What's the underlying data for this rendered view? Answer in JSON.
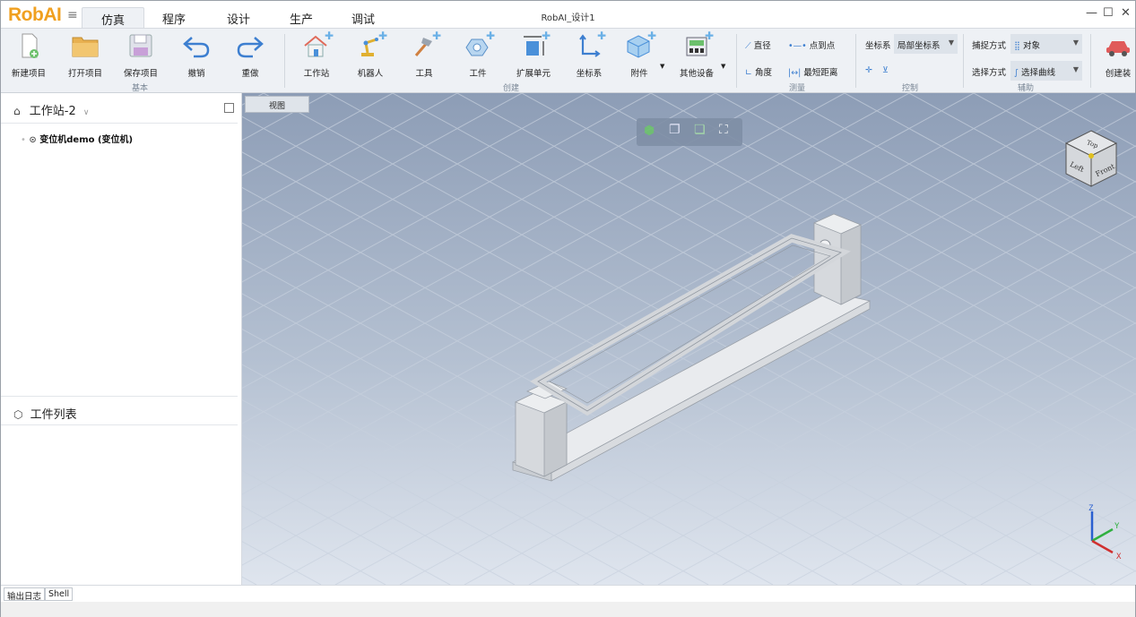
{
  "app": {
    "logo": "RobAI",
    "window_title": "RobAI_设计1",
    "window_controls": {
      "minimize": "—",
      "maximize": "☐",
      "close": "✕"
    }
  },
  "tabs": [
    "仿真",
    "程序",
    "设计",
    "生产",
    "调试"
  ],
  "active_tab": "仿真",
  "ribbon": {
    "basic": {
      "label": "基本",
      "new": "新建项目",
      "open": "打开项目",
      "save": "保存项目",
      "undo": "撤销",
      "redo": "重做"
    },
    "create": {
      "label": "创建",
      "station": "工作站",
      "robot": "机器人",
      "tool": "工具",
      "workpiece": "工件",
      "ext_unit": "扩展单元",
      "frame": "坐标系",
      "accessory": "附件",
      "other": "其他设备"
    },
    "measure": {
      "label": "测量",
      "diameter": "直径",
      "p2p": "点到点",
      "angle": "角度",
      "min_dist": "最短距离"
    },
    "control": {
      "label": "控制",
      "frame_label": "坐标系",
      "frame_value": "局部坐标系"
    },
    "assist": {
      "label": "辅助",
      "snap_label": "捕捉方式",
      "snap_value": "对象",
      "select_label": "选择方式",
      "select_value": "选择曲线"
    },
    "create_assembly": "创建装"
  },
  "left_panel": {
    "station_title": "工作站-2",
    "tree_item": "变位机demo (变位机)",
    "workpiece_list_title": "工件列表"
  },
  "viewport": {
    "tab": "视图",
    "cube_labels": {
      "top": "Top",
      "left": "Left",
      "front": "Front"
    },
    "axes": {
      "x": "X",
      "y": "Y",
      "z": "Z"
    }
  },
  "bottom_tabs": [
    "输出日志",
    "Shell"
  ],
  "colors": {
    "logo": "#f0a020",
    "ribbon_bg": "#eef1f5",
    "viewport_top": "#8d9db6",
    "viewport_bottom": "#dfe5ee",
    "accent_icon": "#4a90d9"
  }
}
